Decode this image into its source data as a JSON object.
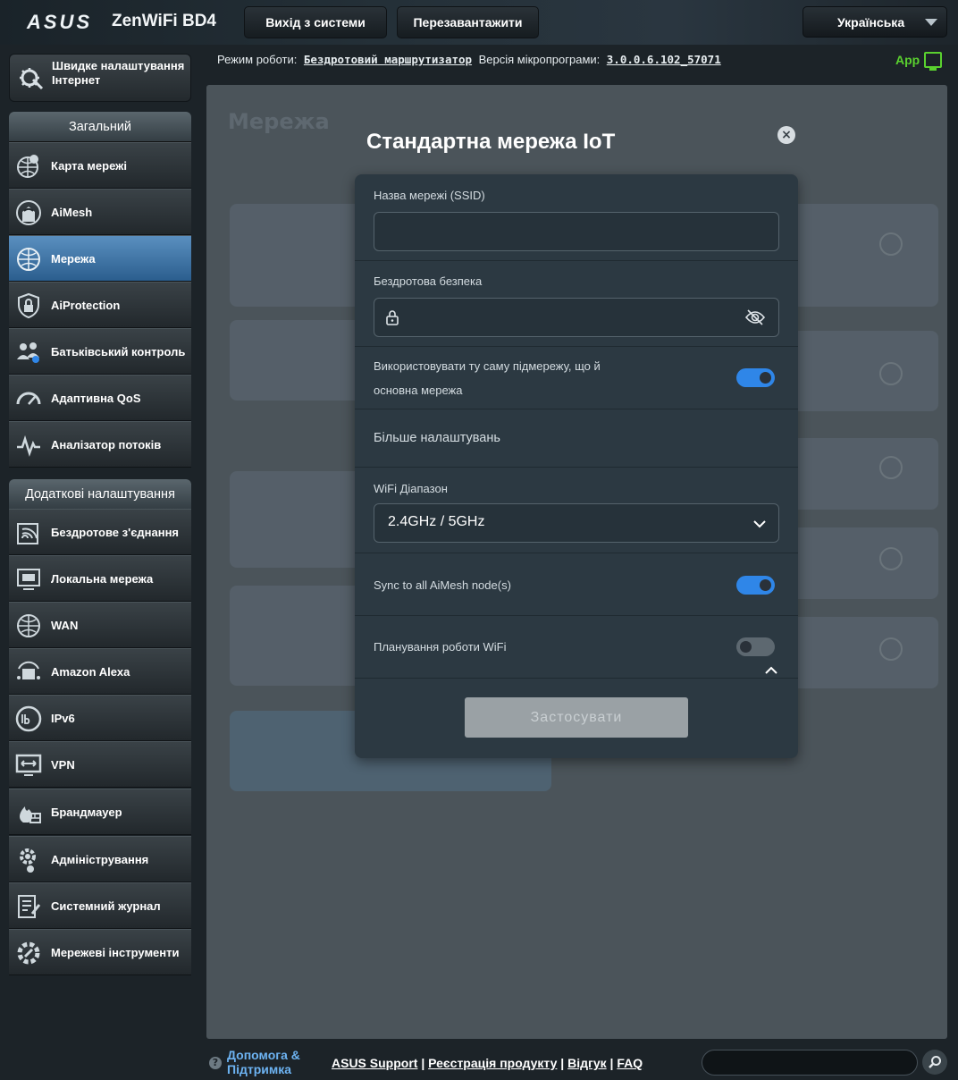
{
  "header": {
    "brand": "ASUS",
    "model": "ZenWiFi BD4",
    "logout_label": "Вихід з системи",
    "reboot_label": "Перезавантажити",
    "language": "Українська"
  },
  "status": {
    "mode_label": "Режим роботи:",
    "mode_value": "Бездротовий маршрутизатор",
    "firmware_label": "Версія мікропрограми:",
    "firmware_value": "3.0.0.6.102_57071",
    "app_label": "App"
  },
  "sidebar": {
    "quick_setup": "Швидке налаштування Інтернет",
    "general_title": "Загальний",
    "general_items": [
      {
        "label": "Карта мережі"
      },
      {
        "label": "AiMesh"
      },
      {
        "label": "Мережа"
      },
      {
        "label": "AiProtection"
      },
      {
        "label": "Батьківський контроль"
      },
      {
        "label": "Адаптивна QoS"
      },
      {
        "label": "Аналізатор потоків"
      }
    ],
    "advanced_title": "Додаткові налаштування",
    "advanced_items": [
      {
        "label": "Бездротове з'єднання"
      },
      {
        "label": "Локальна мережа"
      },
      {
        "label": "WAN"
      },
      {
        "label": "Amazon Alexa"
      },
      {
        "label": "IPv6"
      },
      {
        "label": "VPN"
      },
      {
        "label": "Брандмауер"
      },
      {
        "label": "Адміністрування"
      },
      {
        "label": "Системний журнал"
      },
      {
        "label": "Мережеві інструменти"
      }
    ]
  },
  "background": {
    "page_title": "Мережа"
  },
  "modal": {
    "title": "Стандартна мережа IoT",
    "ssid_label": "Назва мережі (SSID)",
    "ssid_value": "",
    "security_label": "Бездротова безпека",
    "security_value": "",
    "same_subnet_label": "Використовувати ту саму підмережу, що й основна мережа",
    "same_subnet_on": true,
    "more_settings_label": "Більше налаштувань",
    "band_label": "WiFi Діапазон",
    "band_value": "2.4GHz / 5GHz",
    "sync_label": "Sync to all AiMesh node(s)",
    "sync_on": true,
    "schedule_label": "Планування роботи WiFi",
    "schedule_on": false,
    "apply_label": "Застосувати"
  },
  "footer": {
    "help_label": "Допомога & Підтримка",
    "links": [
      "ASUS Support",
      "Реєстрація продукту",
      "Відгук",
      "FAQ"
    ],
    "search_value": ""
  },
  "colors": {
    "accent": "#2f86e8",
    "active_menu": "#3f76a8",
    "app_green": "#5ad12f"
  }
}
